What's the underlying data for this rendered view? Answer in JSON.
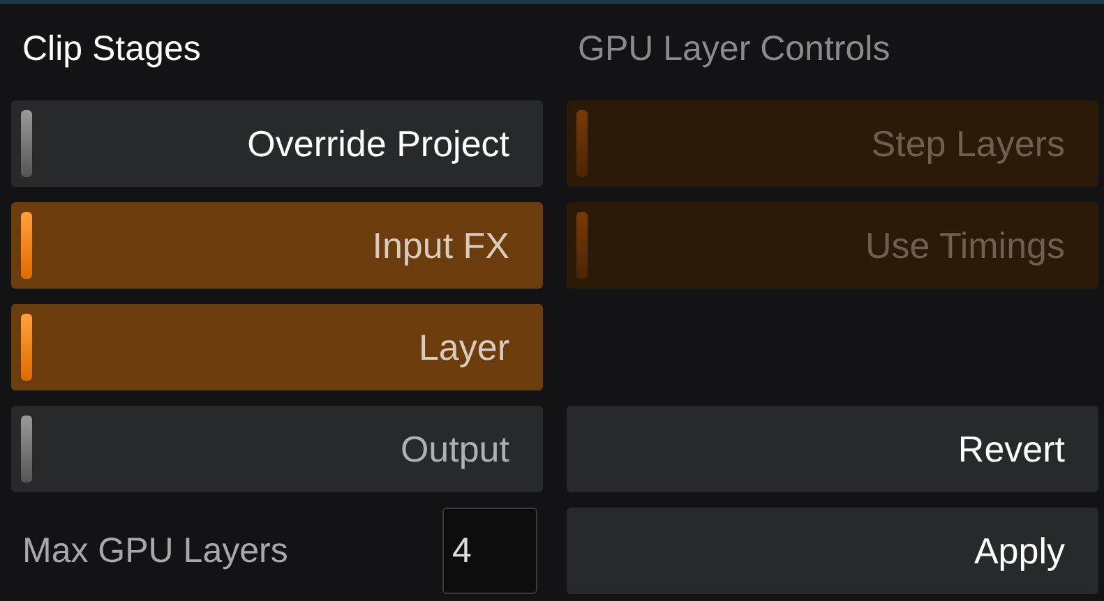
{
  "stages": {
    "title": "Clip Stages",
    "toggles": [
      {
        "label": "Override Project",
        "on": false,
        "highlighted": true
      },
      {
        "label": "Input FX",
        "on": true,
        "highlighted": false
      },
      {
        "label": "Layer",
        "on": true,
        "highlighted": false
      },
      {
        "label": "Output",
        "on": false,
        "highlighted": false
      }
    ],
    "max_layers": {
      "label": "Max GPU Layers",
      "value": "4"
    }
  },
  "gpu": {
    "title": "GPU Layer Controls",
    "disabled": true,
    "toggles": [
      {
        "label": "Step Layers",
        "on": true
      },
      {
        "label": "Use Timings",
        "on": true
      }
    ],
    "buttons": [
      "Revert",
      "Apply"
    ]
  }
}
